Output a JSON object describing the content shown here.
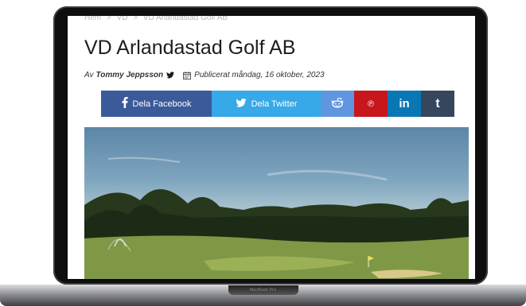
{
  "breadcrumb": {
    "items": [
      "Hem",
      "VD",
      "VD Arlandastad Golf AB"
    ],
    "separator": ">"
  },
  "article": {
    "title": "VD Arlandastad Golf AB",
    "author_prefix": "Av",
    "author": "Tommy Jeppsson",
    "published": "Publicerat måndag, 16 oktober, 2023"
  },
  "share": {
    "facebook_label": "Dela Facebook",
    "twitter_label": "Dela Twitter",
    "reddit_icon": "reddit-icon",
    "pinterest_glyph": "℗",
    "linkedin_glyph": "in",
    "tumblr_glyph": "t"
  },
  "device": {
    "brand_label": "MacBook Pro"
  },
  "colors": {
    "facebook": "#3b5a9a",
    "twitter": "#37a8e8",
    "reddit": "#5f96df",
    "pinterest": "#c8161d",
    "linkedin": "#0a77b5",
    "tumblr": "#35465d"
  }
}
